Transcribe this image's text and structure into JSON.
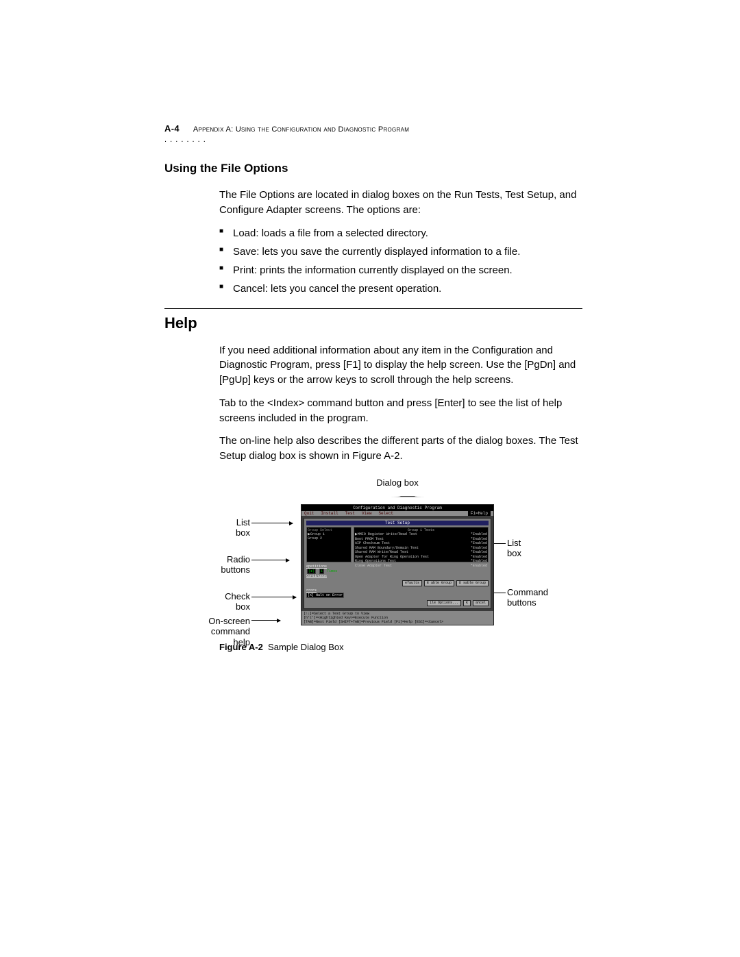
{
  "header": {
    "page_no": "A-4",
    "title": "Appendix A: Using the Configuration and Diagnostic Program",
    "dots": ". . . . . . . ."
  },
  "section_file_options": {
    "heading": "Using the File Options",
    "intro": "The File Options are located in dialog boxes on the Run Tests, Test Setup, and Configure Adapter screens. The options are:",
    "items": [
      "Load: loads a file from a selected directory.",
      "Save: lets you save the currently displayed information to a file.",
      "Print: prints the information currently displayed on the screen.",
      "Cancel: lets you cancel the present operation."
    ]
  },
  "section_help": {
    "heading": "Help",
    "p1": "If you need additional information about any item in the Configuration and Diagnostic Program, press [F1] to display the help screen. Use the [PgDn] and [PgUp] keys or the arrow keys to scroll through the help screens.",
    "p2": "Tab to the <Index> command button and press [Enter] to see the list of help screens included in the program.",
    "p3": "The on-line help also describes the different parts of the dialog boxes. The Test Setup dialog box is shown in Figure A-2."
  },
  "figure": {
    "top_label": "Dialog box",
    "annotations": {
      "left1": "List\nbox",
      "left2": "Radio\nbuttons",
      "left3": "Check\nbox",
      "left4": "On-screen\ncommand\nhelp",
      "right1": "List\nbox",
      "right2": "Command\nbuttons"
    },
    "caption_bold": "Figure A-2",
    "caption_rest": "Sample Dialog Box"
  },
  "screenshot": {
    "title": "Configuration and Diagnostic Program",
    "menu": [
      "Quit",
      "Install",
      "Test",
      "View",
      "Select"
    ],
    "menu_right": "F1=Help",
    "setup_title": "Test Setup",
    "group_header": "Group Select",
    "groups": [
      "▶Group 1",
      " Group 2"
    ],
    "tests_header": "Group 1 Tests",
    "tests": [
      {
        "name": "▶MMIO Register Write/Read Test",
        "status": "*Enabled"
      },
      {
        "name": "Boot PROM Test",
        "status": "*Enabled"
      },
      {
        "name": "AIP Checksum Test",
        "status": "*Enabled"
      },
      {
        "name": "Shared RAM Boundary/Domain Test",
        "status": "*Enabled"
      },
      {
        "name": "Shared RAM Write/Read Test",
        "status": "*Enabled"
      },
      {
        "name": "Open Adapter for Ring Operation Test",
        "status": "*Enabled"
      },
      {
        "name": "Ring Operations Test",
        "status": "*Enabled"
      },
      {
        "name": "Close Adapter Test",
        "status": "*Enabled"
      }
    ],
    "repetitions_label": "epetitions",
    "rep_box1": "(●)",
    "rep_value": "1",
    "rep_times": "Times",
    "continuous": "Continuous",
    "buttons_row1": [
      "efaults",
      "E able Group",
      "D sable Group"
    ],
    "errors_label": "rrors",
    "halt": "[X] Halt on Error",
    "buttons_row2": [
      "ile Options...",
      "K",
      "ancel"
    ],
    "footer": [
      "[↑↓]=Select a Test Group to View",
      "[h't']=<Highlighted Key>=Execute Function",
      "[TAB]=Next Field  [SHIFT+TAB]=Previous Field  [F1]=Help  [ESC]=<Cancel>"
    ]
  }
}
